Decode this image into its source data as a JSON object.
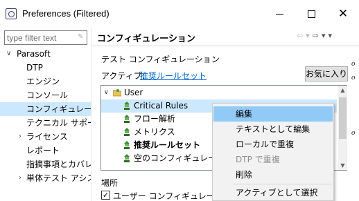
{
  "window": {
    "title": "Preferences (Filtered)",
    "minimize_icon": "minimize-icon",
    "maximize_icon": "maximize-icon",
    "close_glyph": "✕"
  },
  "sidebar": {
    "filter_placeholder": "type filter text",
    "items": [
      {
        "label": "Parasoft",
        "arrow": "∨"
      },
      {
        "label": "DTP"
      },
      {
        "label": "エンジン"
      },
      {
        "label": "コンソール"
      },
      {
        "label": "コンフィギュレーショ"
      },
      {
        "label": "テクニカル サポート"
      },
      {
        "label": "ライセンス",
        "arrow": "›"
      },
      {
        "label": "レポート"
      },
      {
        "label": "指摘事項とカバレ"
      },
      {
        "label": "単体テスト アシス",
        "arrow": "›"
      }
    ]
  },
  "header": {
    "title": "コンフィギュレーション",
    "back_icon": "⇦",
    "dropdown1_icon": "▾",
    "forward_icon": "⇨",
    "dropdown2_icon": "▾",
    "menu_icon": "▾"
  },
  "test_config": {
    "group_label": "テスト コンフィギュレーション",
    "active_label": "アクティブ:",
    "active_value": "推奨ルールセット",
    "favorite_button": "お気に入り",
    "tree": [
      {
        "label": "User",
        "arrow": "∨",
        "icon": "folder-icon"
      },
      {
        "label": "Critical Rules",
        "icon": "config-icon"
      },
      {
        "label": "フロー解析",
        "icon": "config-icon"
      },
      {
        "label": "メトリクス",
        "icon": "config-icon"
      },
      {
        "label": "推奨ルールセット",
        "icon": "config-icon",
        "bold": true
      },
      {
        "label": "空のコンフィギュレーション",
        "icon": "config-icon"
      }
    ]
  },
  "location": {
    "label": "場所",
    "checkbox_label": "ユーザー コンフィギュレーション",
    "checked": true
  },
  "context_menu": {
    "items": [
      {
        "label": "編集"
      },
      {
        "label": "テキストとして編集"
      },
      {
        "label": "ローカルで重複"
      },
      {
        "label": "DTP で重複",
        "disabled": true
      },
      {
        "label": "削除"
      },
      {
        "label": "アクティブとして選択"
      }
    ]
  },
  "background_edge": [
    "o",
    "o",
    "o"
  ],
  "colors": {
    "selection": "#cce8ff",
    "menu_hover": "#91c9f7",
    "link": "#0066cc"
  }
}
